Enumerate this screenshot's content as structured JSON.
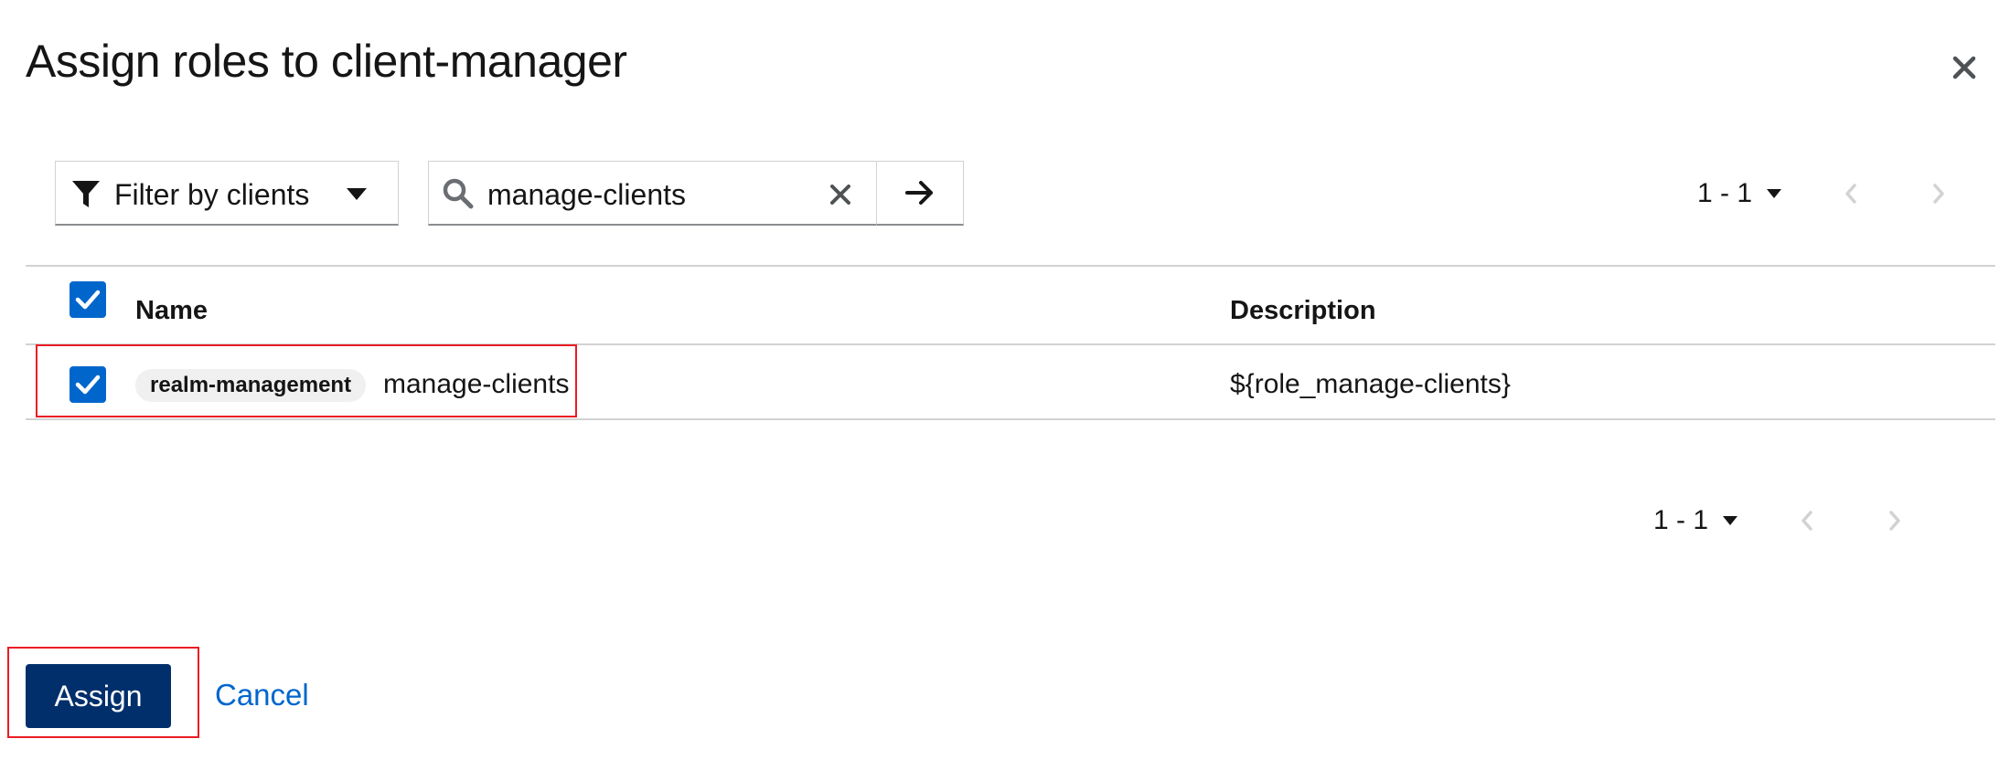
{
  "modal": {
    "title": "Assign roles to client-manager"
  },
  "toolbar": {
    "filter_label": "Filter by clients",
    "search_value": "manage-clients"
  },
  "pagination_top": {
    "range": "1 - 1"
  },
  "pagination_bottom": {
    "range": "1 - 1"
  },
  "table": {
    "columns": {
      "name": "Name",
      "description": "Description"
    },
    "header_checkbox_checked": true,
    "rows": [
      {
        "checked": true,
        "client_tag": "realm-management",
        "name": "manage-clients",
        "description": "${role_manage-clients}"
      }
    ]
  },
  "footer": {
    "assign_label": "Assign",
    "cancel_label": "Cancel"
  },
  "colors": {
    "primary": "#0066cc",
    "assign_button": "#002f6c",
    "highlight": "#ec1c24",
    "link": "#0066cc"
  },
  "icons": [
    "close-icon",
    "filter-icon",
    "caret-down-icon",
    "search-icon",
    "clear-icon",
    "arrow-right-icon",
    "chevron-left-icon",
    "chevron-right-icon",
    "check-icon"
  ]
}
